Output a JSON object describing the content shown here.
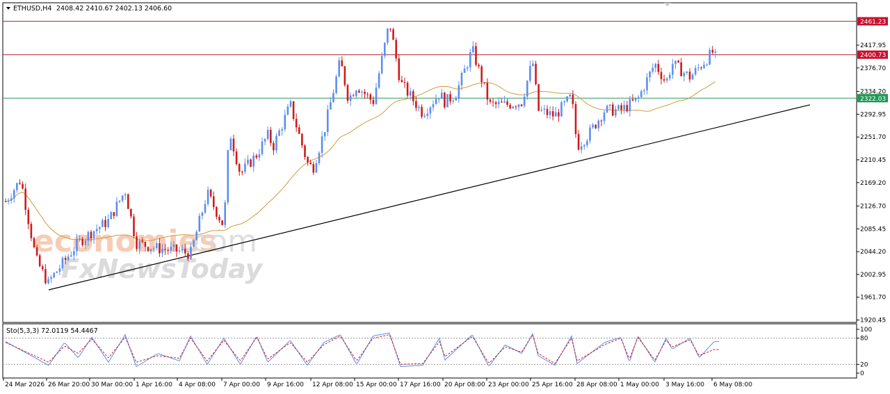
{
  "header": {
    "symbol": "ETHUSD,H4",
    "ohlc": "2408.42 2410.67 2402.13 2406.60"
  },
  "watermark": {
    "brand": "economies",
    "brand_suffix": ".com",
    "tagline": "FxNewsToday"
  },
  "price_axis": {
    "ticks": [
      "2417.95",
      "2376.70",
      "2334.20",
      "2292.95",
      "2251.70",
      "2210.45",
      "2169.20",
      "2126.70",
      "2085.45",
      "2044.20",
      "2002.95",
      "1961.70",
      "1920.45"
    ],
    "tick_values": [
      2417.95,
      2376.7,
      2334.2,
      2292.95,
      2251.7,
      2210.45,
      2169.2,
      2126.7,
      2085.45,
      2044.2,
      2002.95,
      1961.7,
      1920.45
    ]
  },
  "levels": [
    {
      "label": "2461.23",
      "value": 2461.23,
      "color": "#c8102e",
      "line": "#b0202a"
    },
    {
      "label": "2400.73",
      "value": 2400.73,
      "color": "#c8102e",
      "line": "#b0202a"
    },
    {
      "label": "2322.03",
      "value": 2322.03,
      "color": "#1d9a52",
      "line": "#2a9a5c"
    }
  ],
  "time_axis": [
    "24 Mar 2026",
    "26 Mar 20:00",
    "30 Mar 00:00",
    "1 Apr 16:00",
    "4 Apr 08:00",
    "7 Apr 00:00",
    "9 Apr 16:00",
    "12 Apr 08:00",
    "15 Apr 00:00",
    "17 Apr 16:00",
    "20 Apr 08:00",
    "23 Apr 00:00",
    "25 Apr 16:00",
    "28 Apr 08:00",
    "1 May 00:00",
    "3 May 16:00",
    "6 May 08:00"
  ],
  "oscillator": {
    "label": "Sto(5,3,3) 72.0119 54.4467",
    "ticks": [
      "100",
      "80",
      "20",
      "0"
    ],
    "tick_values": [
      100,
      80,
      20,
      0
    ]
  },
  "chart_data": {
    "type": "candlestick",
    "title": "ETHUSD,H4",
    "ylim": [
      1920.45,
      2475
    ],
    "bull_color": "#5b8ef0",
    "bear_color": "#d11a1a",
    "ma_color": "#d39a3a",
    "trendline": {
      "from": [
        "26 Mar 20:00",
        1975
      ],
      "to": [
        "6 May 08:00",
        2310
      ]
    },
    "anchors": [
      [
        "24 Mar 2026",
        2135
      ],
      [
        "25 Mar",
        2175
      ],
      [
        "26 Mar",
        2030
      ],
      [
        "26 Mar 20:00",
        1985
      ],
      [
        "27 Mar",
        1995
      ],
      [
        "29 Mar",
        2060
      ],
      [
        "30 Mar 00:00",
        2080
      ],
      [
        "31 Mar",
        2100
      ],
      [
        "1 Apr",
        2155
      ],
      [
        "1 Apr 16:00",
        2060
      ],
      [
        "3 Apr",
        2050
      ],
      [
        "4 Apr 08:00",
        2045
      ],
      [
        "5 Apr",
        2040
      ],
      [
        "6 Apr",
        2150
      ],
      [
        "7 Apr 00:00",
        2090
      ],
      [
        "7 Apr 08:00",
        2265
      ],
      [
        "8 Apr",
        2185
      ],
      [
        "9 Apr",
        2220
      ],
      [
        "9 Apr 16:00",
        2255
      ],
      [
        "10 Apr",
        2235
      ],
      [
        "11 Apr",
        2310
      ],
      [
        "12 Apr",
        2205
      ],
      [
        "12 Apr 08:00",
        2195
      ],
      [
        "13 Apr",
        2260
      ],
      [
        "14 Apr",
        2390
      ],
      [
        "14 Apr 12:00",
        2320
      ],
      [
        "15 Apr 00:00",
        2345
      ],
      [
        "16 Apr",
        2315
      ],
      [
        "17 Apr",
        2460
      ],
      [
        "17 Apr 16:00",
        2350
      ],
      [
        "19 Apr",
        2295
      ],
      [
        "20 Apr",
        2330
      ],
      [
        "20 Apr 08:00",
        2315
      ],
      [
        "21 Apr",
        2330
      ],
      [
        "22 Apr",
        2410
      ],
      [
        "23 Apr",
        2315
      ],
      [
        "23 Apr 00:00",
        2310
      ],
      [
        "24 Apr",
        2310
      ],
      [
        "25 Apr",
        2315
      ],
      [
        "25 Apr 16:00",
        2390
      ],
      [
        "26 Apr",
        2300
      ],
      [
        "27 Apr",
        2290
      ],
      [
        "28 Apr",
        2325
      ],
      [
        "28 Apr 08:00",
        2235
      ],
      [
        "29 Apr",
        2255
      ],
      [
        "30 Apr",
        2300
      ],
      [
        "1 May 00:00",
        2300
      ],
      [
        "2 May",
        2320
      ],
      [
        "3 May",
        2385
      ],
      [
        "3 May 16:00",
        2350
      ],
      [
        "4 May",
        2385
      ],
      [
        "5 May",
        2360
      ],
      [
        "6 May 08:00",
        2408
      ]
    ],
    "sto_anchors": [
      [
        "24 Mar 2026",
        72,
        70
      ],
      [
        "26 Mar 20:00",
        18,
        25
      ],
      [
        "28 Mar",
        70,
        62
      ],
      [
        "29 Mar",
        35,
        45
      ],
      [
        "30 Mar 00:00",
        82,
        78
      ],
      [
        "31 Mar",
        25,
        35
      ],
      [
        "1 Apr",
        88,
        82
      ],
      [
        "1 Apr 16:00",
        15,
        25
      ],
      [
        "3 Apr",
        45,
        40
      ],
      [
        "4 Apr 08:00",
        28,
        34
      ],
      [
        "5 Apr",
        85,
        80
      ],
      [
        "6 Apr",
        20,
        28
      ],
      [
        "7 Apr 00:00",
        80,
        75
      ],
      [
        "8 Apr",
        20,
        28
      ],
      [
        "9 Apr",
        85,
        82
      ],
      [
        "9 Apr 16:00",
        25,
        32
      ],
      [
        "11 Apr",
        75,
        70
      ],
      [
        "12 Apr",
        18,
        25
      ],
      [
        "13 Apr",
        70,
        65
      ],
      [
        "14 Apr",
        88,
        85
      ],
      [
        "15 Apr 00:00",
        20,
        28
      ],
      [
        "16 Apr",
        85,
        80
      ],
      [
        "17 Apr",
        92,
        88
      ],
      [
        "17 Apr 16:00",
        15,
        20
      ],
      [
        "19 Apr",
        18,
        22
      ],
      [
        "20 Apr",
        80,
        72
      ],
      [
        "20 Apr 08:00",
        30,
        38
      ],
      [
        "22 Apr",
        88,
        84
      ],
      [
        "23 Apr",
        15,
        22
      ],
      [
        "24 Apr",
        65,
        60
      ],
      [
        "25 Apr",
        45,
        48
      ],
      [
        "25 Apr 16:00",
        90,
        88
      ],
      [
        "26 Apr",
        40,
        45
      ],
      [
        "27 Apr",
        18,
        22
      ],
      [
        "28 Apr",
        85,
        80
      ],
      [
        "28 Apr 08:00",
        22,
        28
      ],
      [
        "30 Apr",
        70,
        65
      ],
      [
        "1 May 00:00",
        82,
        80
      ],
      [
        "1 May 12:00",
        25,
        32
      ],
      [
        "2 May",
        85,
        82
      ],
      [
        "3 May",
        25,
        30
      ],
      [
        "3 May 16:00",
        80,
        75
      ],
      [
        "4 May",
        55,
        60
      ],
      [
        "5 May",
        80,
        76
      ],
      [
        "5 May 12:00",
        35,
        40
      ],
      [
        "6 May 08:00",
        72,
        54
      ]
    ]
  }
}
